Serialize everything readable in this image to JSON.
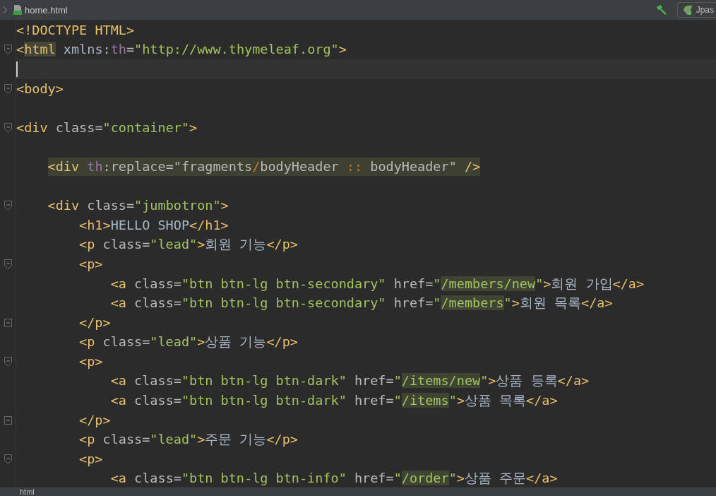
{
  "tab": {
    "label": "home.html",
    "selected": true
  },
  "toolbar": {
    "run_config": "Jpas"
  },
  "lines": [
    {
      "kind": "normal",
      "tokens": [
        {
          "kind": "tag",
          "text": "<!DOCTYPE HTML>"
        }
      ]
    },
    {
      "kind": "normal",
      "fold_marker": {
        "kind": "start"
      },
      "tokens": [
        {
          "kind": "tag",
          "text": "<"
        },
        {
          "kind": "tag-match",
          "text": "html"
        },
        {
          "kind": "text",
          "text": " xmlns:"
        },
        {
          "kind": "ns",
          "text": "th"
        },
        {
          "kind": "attr",
          "text": "="
        },
        {
          "kind": "str",
          "text": "\"http://www.thymeleaf.org\""
        },
        {
          "kind": "tag",
          "text": ">"
        }
      ]
    },
    {
      "kind": "current"
    },
    {
      "kind": "normal",
      "fold_marker": {
        "kind": "start"
      },
      "tokens": [
        {
          "kind": "tag",
          "text": "<body>"
        }
      ]
    },
    {
      "kind": "normal"
    },
    {
      "kind": "normal",
      "fold_marker": {
        "kind": "start"
      },
      "tokens": [
        {
          "kind": "tag",
          "text": "<div "
        },
        {
          "kind": "attr",
          "text": "class="
        },
        {
          "kind": "str",
          "text": "\"container\""
        },
        {
          "kind": "tag",
          "text": ">"
        }
      ],
      "children": [
        {
          "kind": "normal"
        },
        {
          "kind": "highlighted",
          "tokens": [
            {
              "kind": "tag",
              "text": "<div "
            },
            {
              "kind": "ns",
              "text": "th"
            },
            {
              "kind": "attr",
              "text": ":replace=\"fragments"
            },
            {
              "kind": "op",
              "text": "/"
            },
            {
              "kind": "attr",
              "text": "bodyHeader "
            },
            {
              "kind": "op",
              "text": "::"
            },
            {
              "kind": "attr",
              "text": " bodyHeader\" "
            },
            {
              "kind": "tag",
              "text": "/>"
            }
          ]
        },
        {
          "kind": "normal"
        },
        {
          "kind": "normal",
          "fold_marker": {
            "kind": "start"
          },
          "tokens": [
            {
              "kind": "tag",
              "text": "<div "
            },
            {
              "kind": "attr",
              "text": "class="
            },
            {
              "kind": "str",
              "text": "\"jumbotron\""
            },
            {
              "kind": "tag",
              "text": ">"
            }
          ],
          "children": [
            {
              "kind": "normal",
              "tokens": [
                {
                  "kind": "tag",
                  "text": "<h1>"
                },
                {
                  "kind": "text",
                  "text": "HELLO SHOP"
                },
                {
                  "kind": "tag",
                  "text": "</h1>"
                }
              ]
            },
            {
              "kind": "normal",
              "tokens": [
                {
                  "kind": "tag",
                  "text": "<p "
                },
                {
                  "kind": "attr",
                  "text": "class="
                },
                {
                  "kind": "str",
                  "text": "\"lead\""
                },
                {
                  "kind": "tag",
                  "text": ">"
                },
                {
                  "kind": "text",
                  "text": "회원 기능"
                },
                {
                  "kind": "tag",
                  "text": "</p>"
                }
              ]
            },
            {
              "kind": "normal",
              "fold_marker": {
                "kind": "start"
              },
              "tokens": [
                {
                  "kind": "tag",
                  "text": "<p>"
                }
              ],
              "children": [
                {
                  "kind": "normal",
                  "tokens": [
                    {
                      "kind": "tag",
                      "text": "<a "
                    },
                    {
                      "kind": "attr",
                      "text": "class="
                    },
                    {
                      "kind": "str",
                      "text": "\"btn btn-lg btn-secondary\" "
                    },
                    {
                      "kind": "attr",
                      "text": "href="
                    },
                    {
                      "kind": "str",
                      "text": "\""
                    },
                    {
                      "kind": "str-match",
                      "text": "/members/new"
                    },
                    {
                      "kind": "str",
                      "text": "\""
                    },
                    {
                      "kind": "tag",
                      "text": ">"
                    },
                    {
                      "kind": "text",
                      "text": "회원 가입"
                    },
                    {
                      "kind": "tag",
                      "text": "</a>"
                    }
                  ]
                },
                {
                  "kind": "normal",
                  "tokens": [
                    {
                      "kind": "tag",
                      "text": "<a "
                    },
                    {
                      "kind": "attr",
                      "text": "class="
                    },
                    {
                      "kind": "str",
                      "text": "\"btn btn-lg btn-secondary\" "
                    },
                    {
                      "kind": "attr",
                      "text": "href="
                    },
                    {
                      "kind": "str",
                      "text": "\""
                    },
                    {
                      "kind": "str-match",
                      "text": "/members"
                    },
                    {
                      "kind": "str",
                      "text": "\""
                    },
                    {
                      "kind": "tag",
                      "text": ">"
                    },
                    {
                      "kind": "text",
                      "text": "회원 목록"
                    },
                    {
                      "kind": "tag",
                      "text": "</a>"
                    }
                  ]
                }
              ]
            },
            {
              "kind": "normal",
              "fold_marker": {
                "kind": "end"
              },
              "tokens": [
                {
                  "kind": "tag",
                  "text": "</p>"
                }
              ]
            },
            {
              "kind": "normal",
              "tokens": [
                {
                  "kind": "tag",
                  "text": "<p "
                },
                {
                  "kind": "attr",
                  "text": "class="
                },
                {
                  "kind": "str",
                  "text": "\"lead\""
                },
                {
                  "kind": "tag",
                  "text": ">"
                },
                {
                  "kind": "text",
                  "text": "상품 기능"
                },
                {
                  "kind": "tag",
                  "text": "</p>"
                }
              ]
            },
            {
              "kind": "normal",
              "fold_marker": {
                "kind": "start"
              },
              "tokens": [
                {
                  "kind": "tag",
                  "text": "<p>"
                }
              ],
              "children": [
                {
                  "kind": "normal",
                  "tokens": [
                    {
                      "kind": "tag",
                      "text": "<a "
                    },
                    {
                      "kind": "attr",
                      "text": "class="
                    },
                    {
                      "kind": "str",
                      "text": "\"btn btn-lg btn-dark\" "
                    },
                    {
                      "kind": "attr",
                      "text": "href="
                    },
                    {
                      "kind": "str",
                      "text": "\""
                    },
                    {
                      "kind": "str-match",
                      "text": "/items/new"
                    },
                    {
                      "kind": "str",
                      "text": "\""
                    },
                    {
                      "kind": "tag",
                      "text": ">"
                    },
                    {
                      "kind": "text",
                      "text": "상품 등록"
                    },
                    {
                      "kind": "tag",
                      "text": "</a>"
                    }
                  ]
                },
                {
                  "kind": "normal",
                  "tokens": [
                    {
                      "kind": "tag",
                      "text": "<a "
                    },
                    {
                      "kind": "attr",
                      "text": "class="
                    },
                    {
                      "kind": "str",
                      "text": "\"btn btn-lg btn-dark\" "
                    },
                    {
                      "kind": "attr",
                      "text": "href="
                    },
                    {
                      "kind": "str",
                      "text": "\""
                    },
                    {
                      "kind": "str-match",
                      "text": "/items"
                    },
                    {
                      "kind": "str",
                      "text": "\""
                    },
                    {
                      "kind": "tag",
                      "text": ">"
                    },
                    {
                      "kind": "text",
                      "text": "상품 목록"
                    },
                    {
                      "kind": "tag",
                      "text": "</a>"
                    }
                  ]
                }
              ]
            },
            {
              "kind": "normal",
              "fold_marker": {
                "kind": "end"
              },
              "tokens": [
                {
                  "kind": "tag",
                  "text": "</p>"
                }
              ]
            },
            {
              "kind": "normal",
              "tokens": [
                {
                  "kind": "tag",
                  "text": "<p "
                },
                {
                  "kind": "attr",
                  "text": "class="
                },
                {
                  "kind": "str",
                  "text": "\"lead\""
                },
                {
                  "kind": "tag",
                  "text": ">"
                },
                {
                  "kind": "text",
                  "text": "주문 기능"
                },
                {
                  "kind": "tag",
                  "text": "</p>"
                }
              ]
            },
            {
              "kind": "normal",
              "fold_marker": {
                "kind": "start"
              },
              "tokens": [
                {
                  "kind": "tag",
                  "text": "<p>"
                }
              ],
              "children": [
                {
                  "kind": "normal",
                  "tokens": [
                    {
                      "kind": "tag",
                      "text": "<a "
                    },
                    {
                      "kind": "attr",
                      "text": "class="
                    },
                    {
                      "kind": "str",
                      "text": "\"btn btn-lg btn-info\" "
                    },
                    {
                      "kind": "attr",
                      "text": "href="
                    },
                    {
                      "kind": "str",
                      "text": "\""
                    },
                    {
                      "kind": "str-match",
                      "text": "/order"
                    },
                    {
                      "kind": "str",
                      "text": "\""
                    },
                    {
                      "kind": "tag",
                      "text": ">"
                    },
                    {
                      "kind": "text",
                      "text": "상품 주문"
                    },
                    {
                      "kind": "tag",
                      "text": "</a>"
                    }
                  ]
                }
              ]
            }
          ]
        }
      ]
    }
  ],
  "breadcrumb": "html"
}
